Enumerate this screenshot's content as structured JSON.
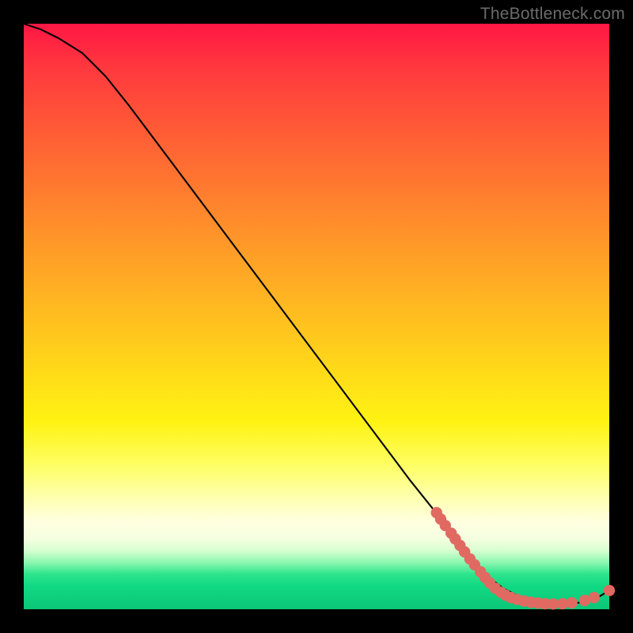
{
  "watermark": "TheBottleneck.com",
  "colors": {
    "curve": "#000000",
    "dot": "#e06a62"
  },
  "chart_data": {
    "type": "line",
    "title": "",
    "xlabel": "",
    "ylabel": "",
    "xlim": [
      0,
      100
    ],
    "ylim": [
      0,
      100
    ],
    "grid": false,
    "series": [
      {
        "name": "bottleneck-curve",
        "x": [
          0,
          3,
          6,
          10,
          14,
          18,
          24,
          30,
          36,
          42,
          48,
          54,
          60,
          66,
          70,
          74,
          78,
          80,
          82,
          84,
          86,
          88,
          90,
          92,
          94,
          96,
          98,
          100
        ],
        "y": [
          100,
          99,
          97.5,
          95,
          91,
          86,
          78,
          70,
          62,
          54,
          46,
          38,
          30,
          22,
          17,
          12,
          7,
          5,
          3.5,
          2.5,
          1.8,
          1.3,
          1,
          0.9,
          1,
          1.3,
          2,
          3.2
        ]
      }
    ],
    "annotations": {
      "dot_cluster_note": "salmon dots clustered along the lower-right tail of the curve",
      "dots_xy": [
        [
          70.5,
          16.5
        ],
        [
          71.2,
          15.4
        ],
        [
          72.0,
          14.3
        ],
        [
          73.0,
          13.0
        ],
        [
          73.7,
          12.0
        ],
        [
          74.5,
          10.9
        ],
        [
          75.3,
          9.8
        ],
        [
          76.2,
          8.6
        ],
        [
          77.0,
          7.6
        ],
        [
          78.0,
          6.4
        ],
        [
          78.8,
          5.4
        ],
        [
          79.6,
          4.5
        ],
        [
          80.5,
          3.6
        ],
        [
          81.5,
          2.9
        ],
        [
          82.3,
          2.4
        ],
        [
          83.2,
          2.0
        ],
        [
          84.2,
          1.7
        ],
        [
          85.4,
          1.4
        ],
        [
          86.6,
          1.2
        ],
        [
          87.8,
          1.05
        ],
        [
          89.0,
          0.95
        ],
        [
          90.4,
          0.9
        ],
        [
          92.0,
          0.95
        ],
        [
          93.6,
          1.1
        ],
        [
          95.8,
          1.5
        ],
        [
          97.4,
          2.0
        ],
        [
          100.0,
          3.2
        ]
      ]
    }
  }
}
